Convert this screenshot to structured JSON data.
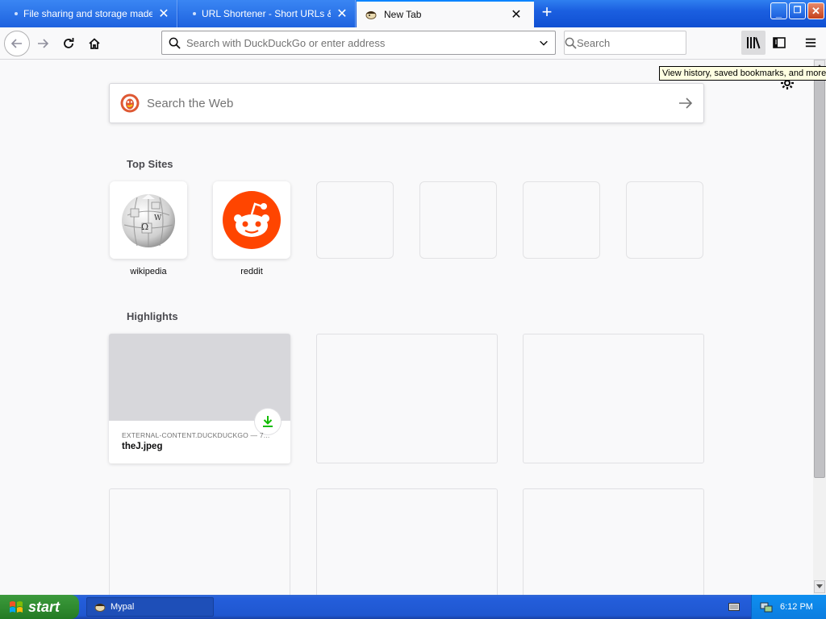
{
  "tabs": [
    {
      "title": "File sharing and storage made si",
      "active": false
    },
    {
      "title": "URL Shortener - Short URLs & Cu",
      "active": false
    },
    {
      "title": "New Tab",
      "active": true
    }
  ],
  "navbar": {
    "url_placeholder": "Search with DuckDuckGo or enter address",
    "search_placeholder": "Search"
  },
  "tooltip": "View history, saved bookmarks, and more",
  "content": {
    "websearch_placeholder": "Search the Web",
    "topsites_title": "Top Sites",
    "topsites": [
      {
        "label": "wikipedia",
        "icon": "wikipedia-globe-icon"
      },
      {
        "label": "reddit",
        "icon": "reddit-alien-icon"
      }
    ],
    "highlights_title": "Highlights",
    "highlight": {
      "host": "EXTERNAL-CONTENT.DUCKDUCKGO — 7...",
      "filename": "theJ.jpeg"
    }
  },
  "taskbar": {
    "start_label": "start",
    "task_label": "Mypal",
    "clock": "6:12 PM"
  },
  "colors": {
    "accent": "#0a84ff",
    "reddit": "#ff4500",
    "download_green": "#12bc00"
  }
}
